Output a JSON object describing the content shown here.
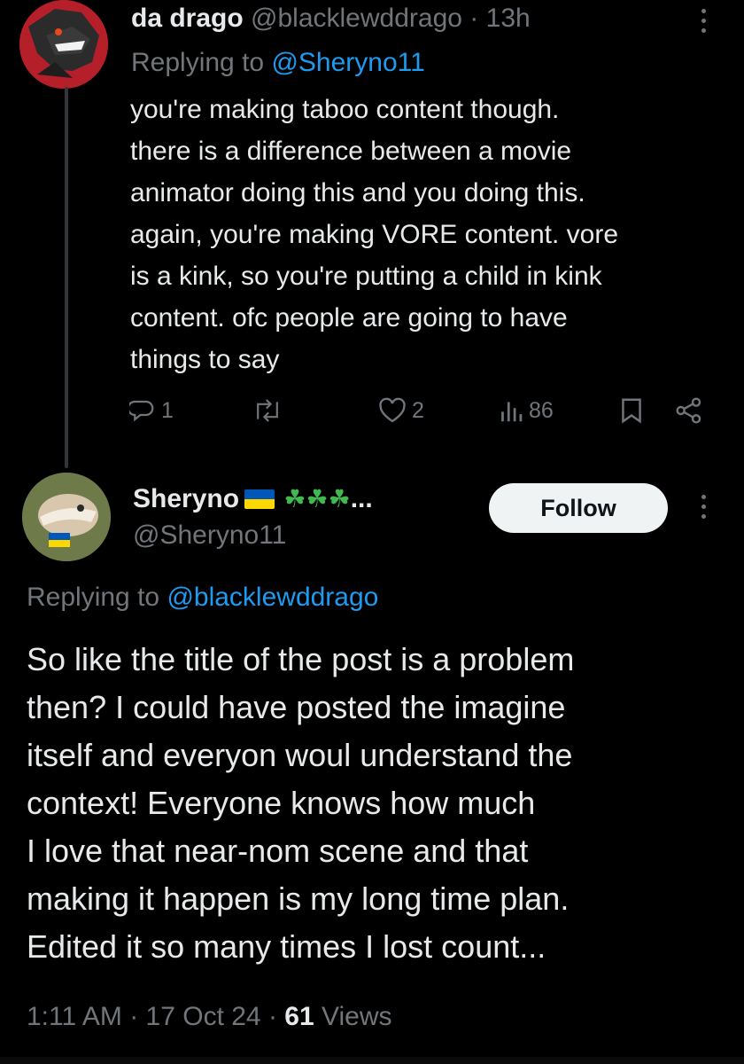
{
  "reply_tweet": {
    "display_name": "da drago",
    "handle": "@blacklewddrago",
    "time": "13h",
    "replying_prefix": "Replying to",
    "replying_to": "@Sheryno11",
    "text_lines": [
      "you're making taboo content though.",
      "there is a difference between a movie",
      "animator doing this and you doing this.",
      "again, you're making VORE content. vore",
      "is a kink, so you're putting a child in kink",
      "content. ofc people are going to have",
      "things to say"
    ],
    "actions": {
      "replies": "1",
      "likes": "2",
      "views": "86"
    }
  },
  "main_tweet": {
    "display_name": "Sheryno",
    "name_ellipsis": "...",
    "handle": "@Sheryno11",
    "follow_label": "Follow",
    "replying_prefix": "Replying to",
    "replying_to": "@blacklewddrago",
    "text_lines": [
      "So like the title of the post is a problem",
      "then? I could have posted the imagine",
      "itself and everyon woul understand the",
      "context! Everyone knows how much",
      "I love that near-nom scene and that",
      "making it happen is my long time plan.",
      "Edited it so many times I lost count..."
    ],
    "time": "1:11 AM",
    "date": "17 Oct 24",
    "views_count": "61",
    "views_label": "Views"
  },
  "separator": "·",
  "icons": [
    "reply-icon",
    "retweet-icon",
    "like-icon",
    "views-icon",
    "bookmark-icon",
    "share-icon",
    "more-icon",
    "ukraine-flag-icon",
    "clover-icon"
  ],
  "colors": {
    "background": "#000000",
    "text": "#e7e9ea",
    "muted": "#71767b",
    "link": "#1d9bf0",
    "follow_bg": "#eff3f4"
  }
}
